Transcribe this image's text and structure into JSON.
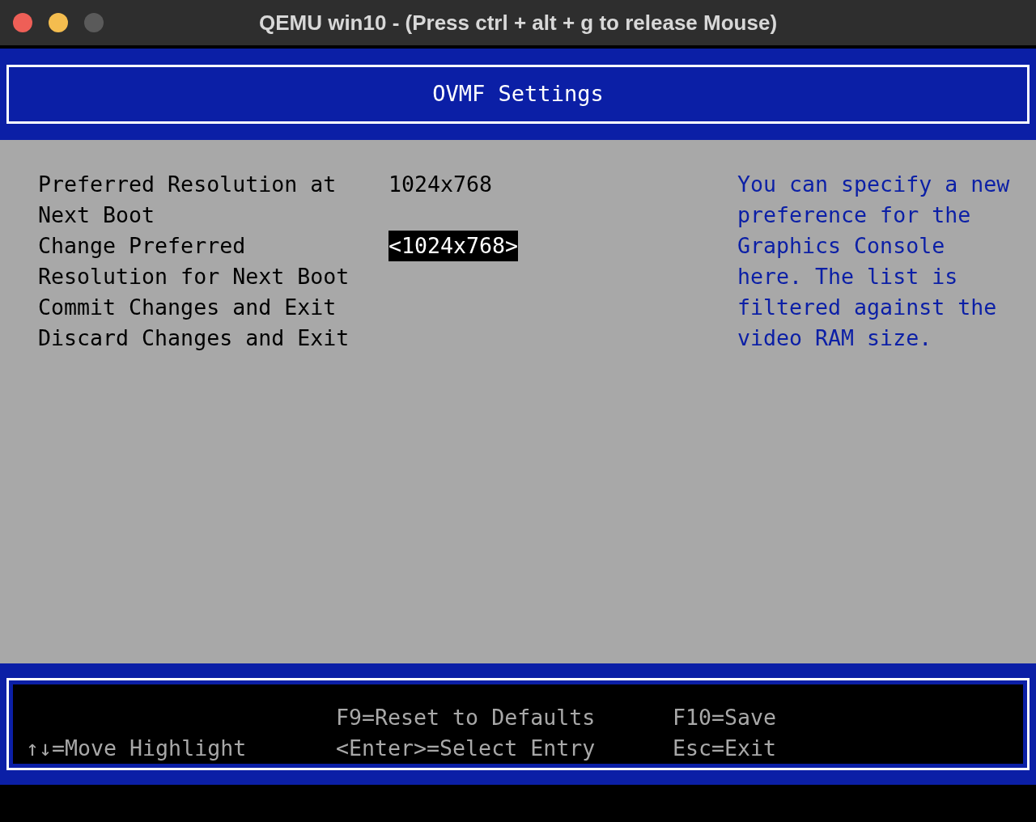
{
  "window": {
    "title": "QEMU win10 - (Press ctrl + alt + g to release Mouse)"
  },
  "header": {
    "title": "OVMF Settings"
  },
  "options": [
    {
      "label": "Preferred Resolution at Next Boot",
      "value": "1024x768",
      "selected": false
    },
    {
      "label": "Change Preferred Resolution for Next Boot",
      "value": "<1024x768>",
      "selected": true
    },
    {
      "label": "Commit Changes and Exit",
      "selected": false
    },
    {
      "label": "Discard Changes and Exit",
      "selected": false
    }
  ],
  "help_text": "You can specify a new preference for the Graphics Console here. The list is filtered against the video RAM size.",
  "footer": {
    "columns": [
      [
        "↑↓=Move Highlight"
      ],
      [
        "F9=Reset to Defaults",
        "<Enter>=Select Entry"
      ],
      [
        "F10=Save",
        "Esc=Exit"
      ]
    ]
  }
}
